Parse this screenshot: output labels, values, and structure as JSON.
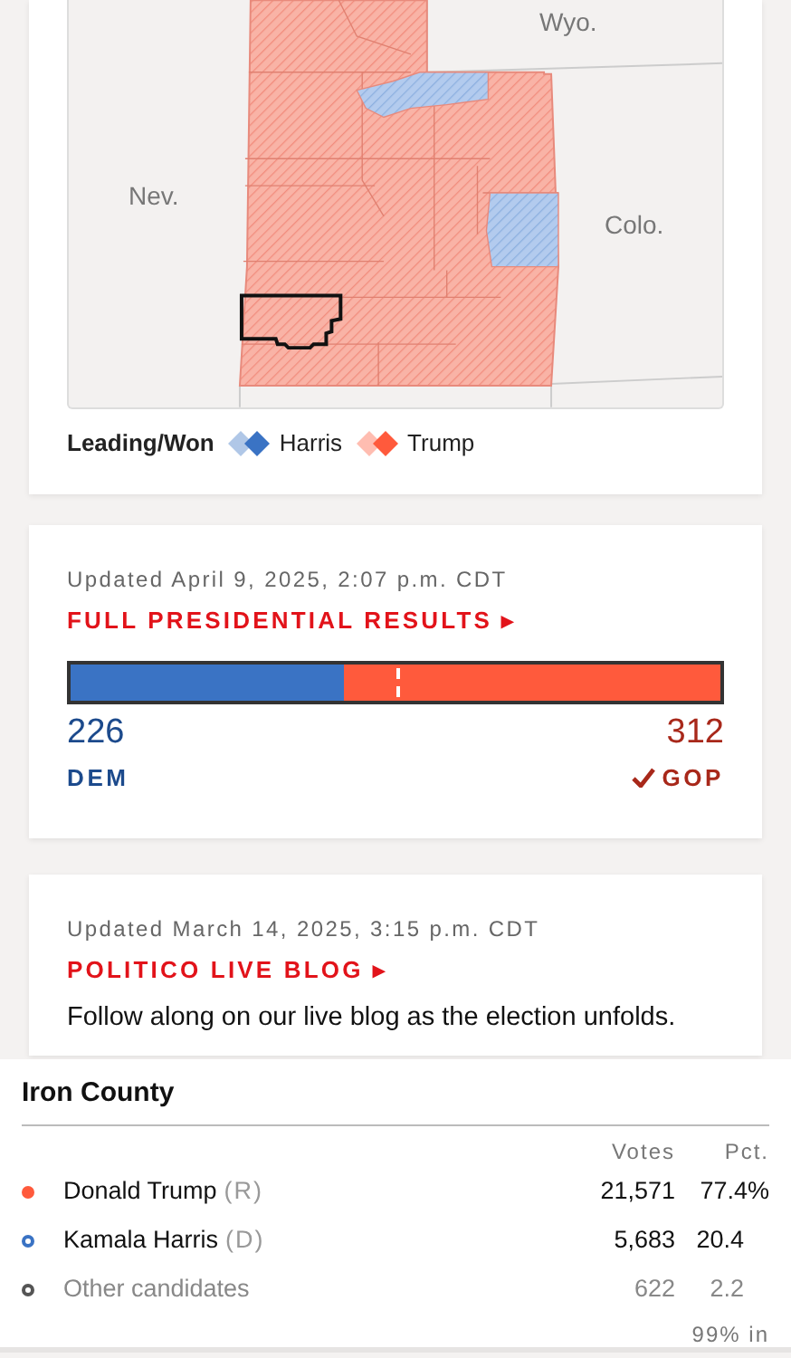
{
  "map": {
    "state_labels": [
      {
        "text": "Wyo."
      },
      {
        "text": "Nev."
      },
      {
        "text": "Colo."
      }
    ],
    "legend": {
      "title": "Leading/Won",
      "items": [
        {
          "label": "Harris",
          "color": "#3a73c4"
        },
        {
          "label": "Trump",
          "color": "#ff5a3c"
        }
      ]
    }
  },
  "results": {
    "updated": "Updated April 9, 2025, 2:07 p.m. CDT",
    "link": "FULL PRESIDENTIAL RESULTS ▸",
    "dem": {
      "votes": "226",
      "label": "DEM",
      "level": 0.42
    },
    "gop": {
      "votes": "312",
      "label": "GOP",
      "won": true
    }
  },
  "blog": {
    "updated": "Updated March 14, 2025, 3:15 p.m. CDT",
    "link": "POLITICO LIVE BLOG ▸",
    "text": "Follow along on our live blog as the election unfolds."
  },
  "tooltip": {
    "title": "Iron County",
    "columns": [
      "Votes",
      "Pct."
    ],
    "rows": [
      {
        "name": "Donald Trump",
        "party": "(R)",
        "votes": "21,571",
        "pct": "77.4%",
        "color": "#ff5a3c",
        "kind": "candidate",
        "leading": true
      },
      {
        "name": "Kamala Harris",
        "party": "(D)",
        "votes": "5,683",
        "pct": "20.4",
        "color": "#3a73c4",
        "kind": "candidate",
        "leading": false
      },
      {
        "name": "Other candidates",
        "votes": "622",
        "pct": "2.2",
        "color": "#555555",
        "kind": "other",
        "leading": false
      }
    ],
    "reporting": "99% in"
  }
}
